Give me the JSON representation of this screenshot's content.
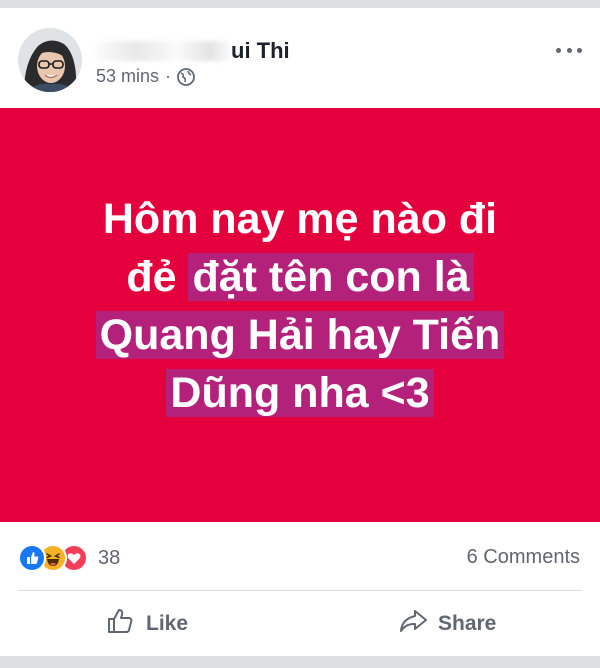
{
  "post": {
    "author_visible": "ui Thi",
    "time": "53 mins",
    "separator": "·",
    "privacy_icon": "globe-icon",
    "menu_icon": "more-horizontal-icon"
  },
  "banner": {
    "background": "#e3003d",
    "highlight": "#b3217a",
    "line1": "Hôm nay mẹ nào đi",
    "line2_plain": "đẻ ",
    "line2_highlight": "đặt tên con là",
    "line3_highlight": "Quang Hải hay Tiến",
    "line4_highlight": "Dũng nha <3"
  },
  "stats": {
    "reactions": [
      "like-reaction-icon",
      "haha-reaction-icon",
      "love-reaction-icon"
    ],
    "reaction_count": "38",
    "comments": "6 Comments"
  },
  "actions": {
    "like_label": "Like",
    "share_label": "Share"
  },
  "colors": {
    "like_blue": "#1877f2",
    "haha_yellow": "#f7b125",
    "love_red": "#f33e58",
    "meta_gray": "#606770"
  }
}
